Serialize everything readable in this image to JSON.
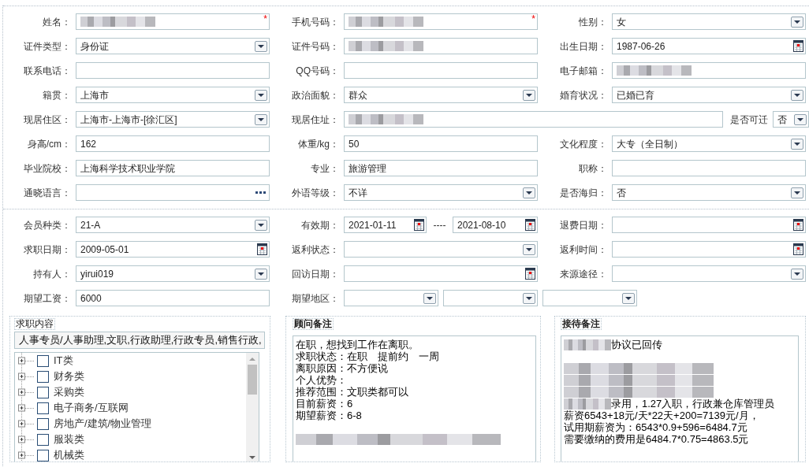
{
  "sections": [
    {
      "rows": [
        {
          "cells": [
            {
              "label": "姓名：",
              "kind": "text",
              "redacted": true,
              "required_mark": "*"
            },
            {
              "label": "手机号码：",
              "kind": "text",
              "redacted": true,
              "required_mark": "*"
            },
            {
              "label": "性别：",
              "kind": "select",
              "value": "女"
            }
          ]
        },
        {
          "cells": [
            {
              "label": "证件类型：",
              "kind": "select",
              "value": "身份证"
            },
            {
              "label": "证件号码：",
              "kind": "text",
              "redacted": true
            },
            {
              "label": "出生日期：",
              "kind": "date",
              "value": "1987-06-26"
            }
          ]
        },
        {
          "cells": [
            {
              "label": "联系电话：",
              "kind": "text"
            },
            {
              "label": "QQ号码：",
              "kind": "text"
            },
            {
              "label": "电子邮箱：",
              "kind": "text",
              "redacted": true
            }
          ]
        },
        {
          "cells": [
            {
              "label": "籍贯：",
              "kind": "select",
              "value": "上海市"
            },
            {
              "label": "政治面貌：",
              "kind": "select",
              "value": "群众"
            },
            {
              "label": "婚育状况：",
              "kind": "select",
              "value": "已婚已育"
            }
          ]
        },
        {
          "cells": [
            {
              "label": "现居住区：",
              "kind": "select",
              "value": " 上海市-上海市-[徐汇区]"
            },
            {
              "label": "现居住址：",
              "kind": "text",
              "redacted": true,
              "wide": true
            },
            {
              "label": "是否可迁",
              "kind": "select",
              "value": "否",
              "inline": true
            }
          ]
        },
        {
          "cells": [
            {
              "label": "身高/cm：",
              "kind": "text",
              "value": "162"
            },
            {
              "label": "体重/kg：",
              "kind": "text",
              "value": "50"
            },
            {
              "label": "文化程度：",
              "kind": "select",
              "value": "大专（全日制）"
            }
          ]
        },
        {
          "cells": [
            {
              "label": "毕业院校：",
              "kind": "text",
              "value": "上海科学技术职业学院"
            },
            {
              "label": "专业：",
              "kind": "text",
              "value": "旅游管理"
            },
            {
              "label": "职称：",
              "kind": "text"
            }
          ]
        },
        {
          "cells": [
            {
              "label": "通晓语言：",
              "kind": "lookup"
            },
            {
              "label": "外语等级：",
              "kind": "select",
              "value": "不详"
            },
            {
              "label": "是否海归：",
              "kind": "select",
              "value": "否"
            }
          ]
        }
      ]
    },
    {
      "rows": [
        {
          "cells": [
            {
              "label": "会员种类：",
              "kind": "select",
              "value": " 21-A"
            },
            {
              "label": "有效期：",
              "kind": "daterange",
              "values": [
                "2021-01-11",
                "2021-08-10"
              ],
              "separator": "----"
            },
            {
              "label": "退费日期：",
              "kind": "date"
            }
          ]
        },
        {
          "cells": [
            {
              "label": "求职日期：",
              "kind": "date",
              "value": "2009-05-01"
            },
            {
              "label": "返利状态：",
              "kind": "select"
            },
            {
              "label": "返利时间：",
              "kind": "date"
            }
          ]
        },
        {
          "cells": [
            {
              "label": "持有人：",
              "kind": "select",
              "value": "yirui019"
            },
            {
              "label": "回访日期：",
              "kind": "date"
            },
            {
              "label": "来源途径：",
              "kind": "select"
            }
          ]
        },
        {
          "cells": [
            {
              "label": "期望工资：",
              "kind": "text",
              "value": "6000"
            },
            {
              "label": "期望地区：",
              "kind": "region",
              "wide": true
            }
          ]
        }
      ]
    }
  ],
  "panels": [
    {
      "kind": "tree",
      "title": "求职内容",
      "emphasized": false,
      "value": "人事专员/人事助理,文职,行政助理,行政专员,销售行政,",
      "items": [
        {
          "label": "IT类",
          "checked": false,
          "expanded": false
        },
        {
          "label": "财务类",
          "checked": false,
          "expanded": false
        },
        {
          "label": "采购类",
          "checked": false,
          "expanded": false
        },
        {
          "label": "电子商务/互联网",
          "checked": false,
          "expanded": false
        },
        {
          "label": "房地产/建筑/物业管理",
          "checked": false,
          "expanded": false
        },
        {
          "label": "服装类",
          "checked": false,
          "expanded": false
        },
        {
          "label": "机械类",
          "checked": false,
          "expanded": false
        }
      ]
    },
    {
      "kind": "notes",
      "title": "顾问备注",
      "emphasized": true,
      "lines": [
        {
          "kind": "text",
          "text": "在职，想找到工作在离职。"
        },
        {
          "kind": "text",
          "text": "求职状态：在职　提前约　一周"
        },
        {
          "kind": "text",
          "text": "离职原因：不方便说"
        },
        {
          "kind": "text",
          "text": "个人优势："
        },
        {
          "kind": "text",
          "text": "推荐范围：文职类都可以"
        },
        {
          "kind": "text",
          "text": "目前薪资：6"
        },
        {
          "kind": "text",
          "text": "期望薪资：6-8"
        },
        {
          "kind": "blank"
        },
        {
          "kind": "redacted"
        }
      ]
    },
    {
      "kind": "notes",
      "title": "接待备注",
      "emphasized": true,
      "lines": [
        {
          "kind": "text",
          "text": " 协议已回传",
          "redacted_prefix": true
        },
        {
          "kind": "blank"
        },
        {
          "kind": "redacted"
        },
        {
          "kind": "redacted"
        },
        {
          "kind": "redacted"
        },
        {
          "kind": "text",
          "text": "录用，1.27入职，行政兼仓库管理员",
          "redacted_prefix": true
        },
        {
          "kind": "text",
          "text": "薪资6543+18元/天*22天+200=7139元/月，"
        },
        {
          "kind": "text",
          "text": "试用期薪资为：6543*0.9+596=6484.7元"
        },
        {
          "kind": "text",
          "text": "需要缴纳的费用是6484.7*0.75=4863.5元"
        }
      ]
    }
  ]
}
